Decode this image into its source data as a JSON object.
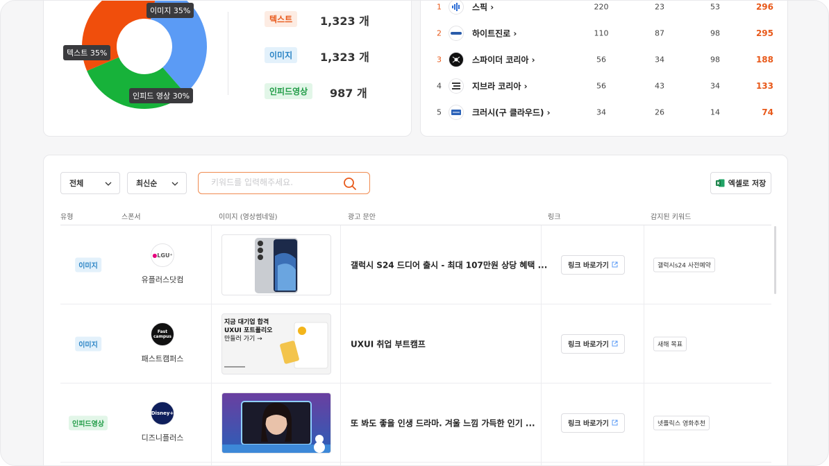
{
  "donut": {
    "colors": {
      "text": "#f04e0c",
      "image": "#5b9bf5",
      "infeed": "#17b23a"
    },
    "tooltips": {
      "image": "이미지 35%",
      "text": "텍스트 35%",
      "infeed": "인피드 영상 30%"
    },
    "legend": [
      {
        "label": "텍스트",
        "count": "1,323 개"
      },
      {
        "label": "이미지",
        "count": "1,323 개"
      },
      {
        "label": "인피드영상",
        "count": "987 개"
      }
    ]
  },
  "chart_data": {
    "type": "pie",
    "categories": [
      "이미지",
      "텍스트",
      "인피드 영상"
    ],
    "values": [
      35,
      35,
      30
    ]
  },
  "ranking": [
    {
      "rank": "1",
      "name": "스픽",
      "c1": "220",
      "c2": "23",
      "c3": "53",
      "total": "296",
      "icon": "speak-logo-icon"
    },
    {
      "rank": "2",
      "name": "하이트진로",
      "c1": "110",
      "c2": "87",
      "c3": "98",
      "total": "295",
      "icon": "hitejinro-logo-icon"
    },
    {
      "rank": "3",
      "name": "스파이더 코리아",
      "c1": "56",
      "c2": "34",
      "c3": "98",
      "total": "188",
      "icon": "spyder-logo-icon"
    },
    {
      "rank": "4",
      "name": "지브라 코리아",
      "c1": "56",
      "c2": "43",
      "c3": "34",
      "total": "133",
      "icon": "zebra-logo-icon"
    },
    {
      "rank": "5",
      "name": "크러시(구 클라우드)",
      "c1": "34",
      "c2": "26",
      "c3": "14",
      "total": "74",
      "icon": "kloud-logo-icon"
    }
  ],
  "filters": {
    "type_select": "전체",
    "sort_select": "최신순",
    "search_placeholder": "키워드를 입력해주세요.",
    "excel_label": "엑셀로 저장"
  },
  "table": {
    "headers": [
      "유형",
      "스폰서",
      "이미지 (영상썸네일)",
      "광고 문안",
      "링크",
      "감지된 키워드"
    ],
    "rows": [
      {
        "type": "이미지",
        "sponsor": "유플러스닷컴",
        "logo_text": "LGU⁺",
        "ad_text": "갤럭시 S24 드디어 출시 - 최대 107만원 상당 혜택 ...",
        "link": "링크 바로가기",
        "keyword": "갤럭시s24 사전예약"
      },
      {
        "type": "이미지",
        "sponsor": "패스트캠퍼스",
        "logo_text": "Fast campus",
        "ad_text": "UXUI 취업 부트캠프",
        "link": "링크 바로가기",
        "keyword": "새해 목표",
        "thumb_lines": [
          "지금 대기업 합격",
          "UXUI 포트폴리오",
          "만들러 가기 →"
        ]
      },
      {
        "type": "인피드영상",
        "sponsor": "디즈니플러스",
        "logo_text": "Disney+",
        "ad_text": "또 봐도 좋을 인생 드라마. 겨울 느낌 가득한 인기 ...",
        "link": "링크 바로가기",
        "keyword": "넷플릭스 영화추천"
      }
    ]
  }
}
